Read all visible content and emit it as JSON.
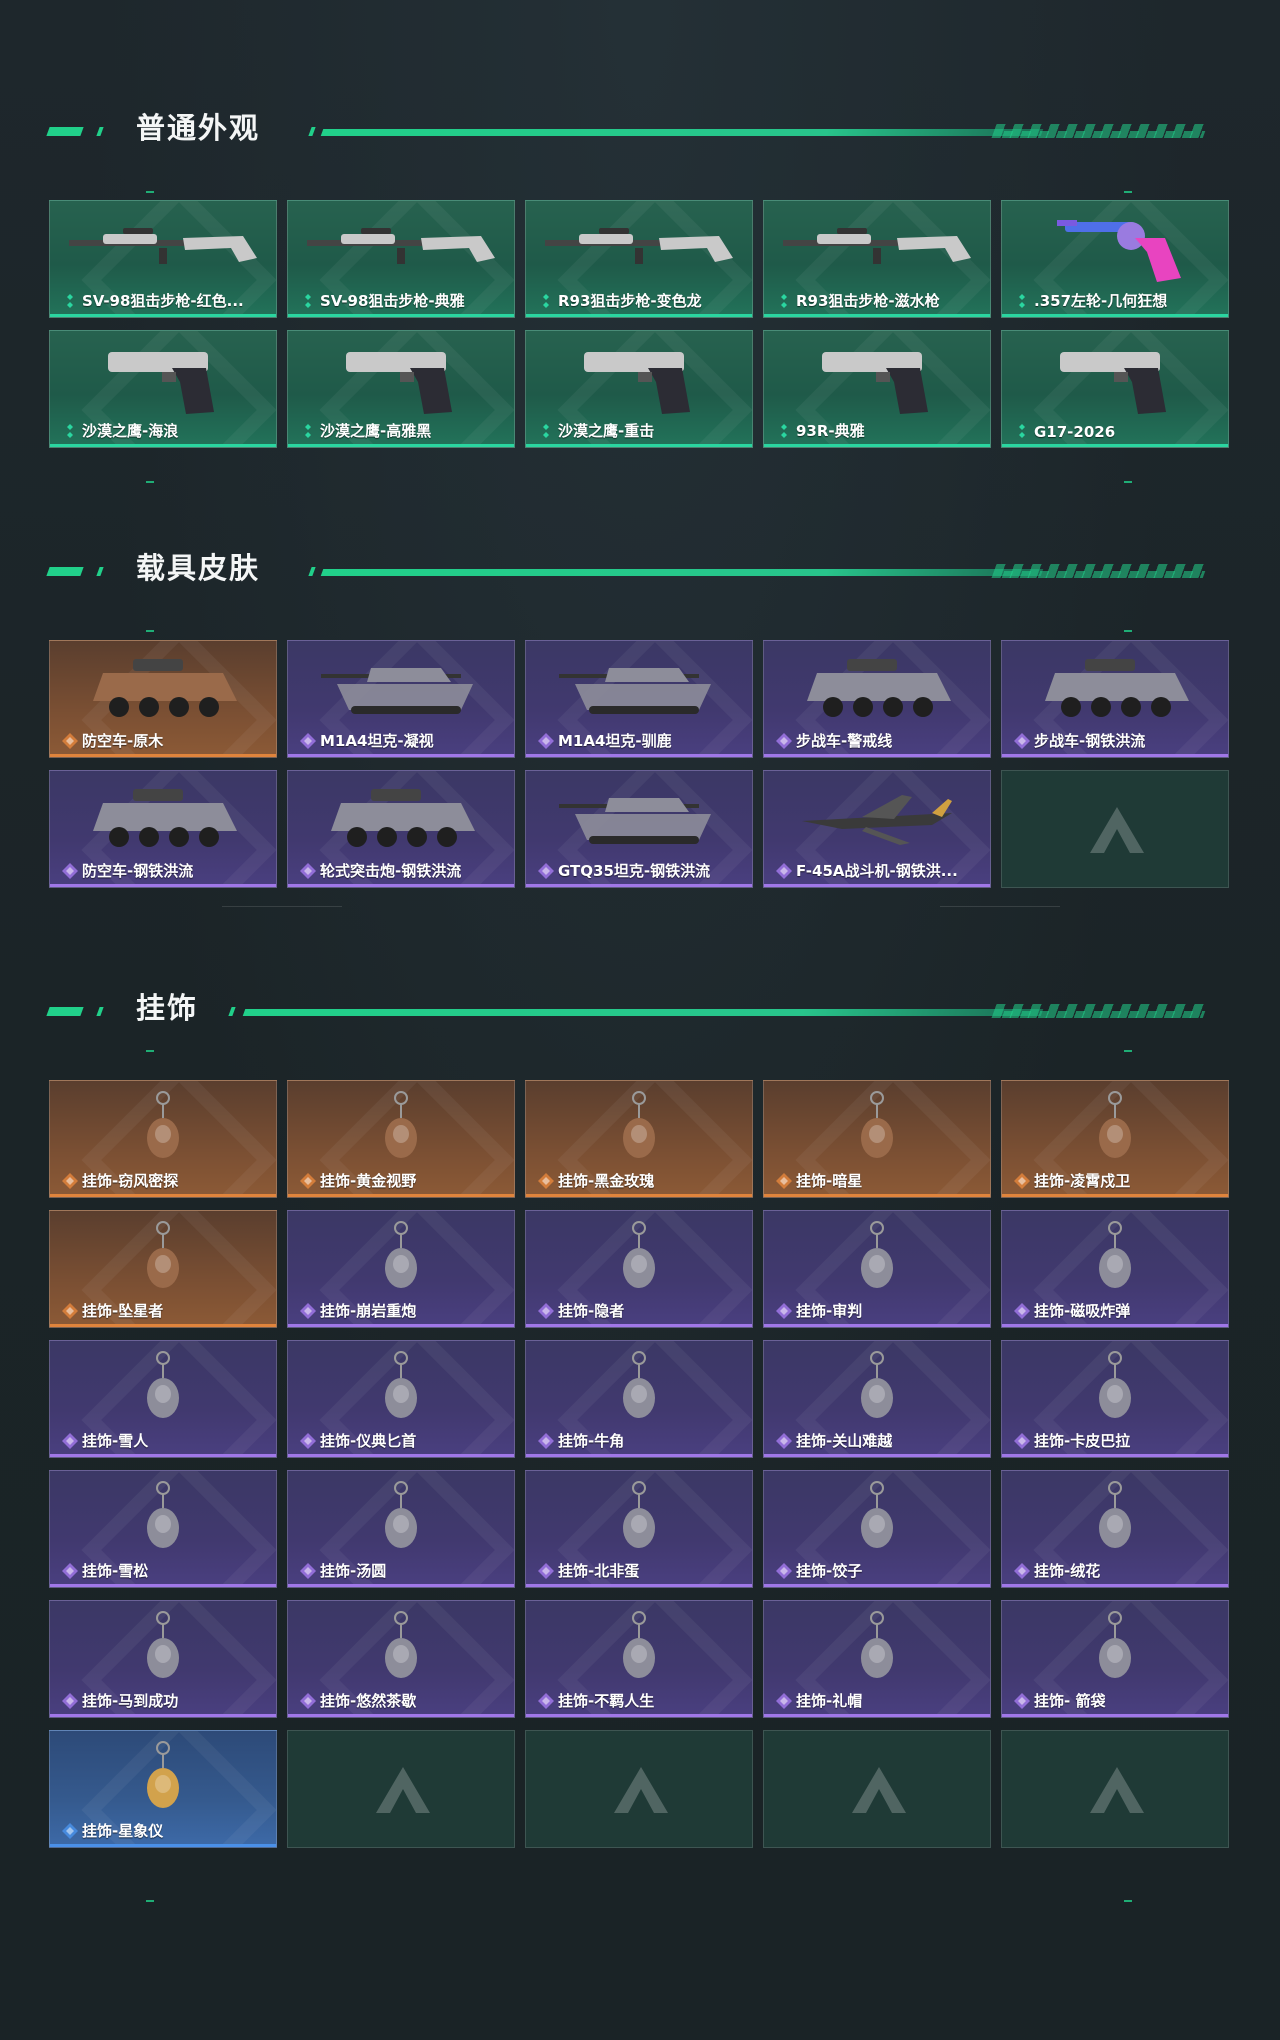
{
  "sections": [
    {
      "title": "普通外观",
      "items": [
        {
          "label": "SV-98狙击步枪-红色...",
          "rarity": "green",
          "icon": "sniper-rifle-icon"
        },
        {
          "label": "SV-98狙击步枪-典雅",
          "rarity": "green",
          "icon": "sniper-rifle-icon"
        },
        {
          "label": "R93狙击步枪-变色龙",
          "rarity": "green",
          "icon": "sniper-rifle-icon"
        },
        {
          "label": "R93狙击步枪-滋水枪",
          "rarity": "green",
          "icon": "sniper-rifle-icon"
        },
        {
          "label": ".357左轮-几何狂想",
          "rarity": "green",
          "icon": "revolver-icon"
        },
        {
          "label": "沙漠之鹰-海浪",
          "rarity": "green",
          "icon": "pistol-icon"
        },
        {
          "label": "沙漠之鹰-高雅黑",
          "rarity": "green",
          "icon": "pistol-icon"
        },
        {
          "label": "沙漠之鹰-重击",
          "rarity": "green",
          "icon": "pistol-icon"
        },
        {
          "label": "93R-典雅",
          "rarity": "green",
          "icon": "pistol-icon"
        },
        {
          "label": "G17-2026",
          "rarity": "green",
          "icon": "pistol-icon"
        }
      ]
    },
    {
      "title": "载具皮肤",
      "items": [
        {
          "label": "防空车-原木",
          "rarity": "orange",
          "icon": "armored-vehicle-icon"
        },
        {
          "label": "M1A4坦克-凝视",
          "rarity": "purple",
          "icon": "tank-icon"
        },
        {
          "label": "M1A4坦克-驯鹿",
          "rarity": "purple",
          "icon": "tank-icon"
        },
        {
          "label": "步战车-警戒线",
          "rarity": "purple",
          "icon": "armored-vehicle-icon"
        },
        {
          "label": "步战车-钢铁洪流",
          "rarity": "purple",
          "icon": "armored-vehicle-icon"
        },
        {
          "label": "防空车-钢铁洪流",
          "rarity": "purple",
          "icon": "armored-vehicle-icon"
        },
        {
          "label": "轮式突击炮-钢铁洪流",
          "rarity": "purple",
          "icon": "armored-vehicle-icon"
        },
        {
          "label": "GTQ35坦克-钢铁洪流",
          "rarity": "purple",
          "icon": "tank-icon"
        },
        {
          "label": "F-45A战斗机-钢铁洪...",
          "rarity": "purple",
          "icon": "fighter-jet-icon"
        },
        {
          "label": "",
          "rarity": "empty",
          "icon": ""
        }
      ]
    },
    {
      "title": "挂饰",
      "items": [
        {
          "label": "挂饰-窃风密探",
          "rarity": "orange",
          "icon": "charm-icon"
        },
        {
          "label": "挂饰-黄金视野",
          "rarity": "orange",
          "icon": "charm-icon"
        },
        {
          "label": "挂饰-黑金玫瑰",
          "rarity": "orange",
          "icon": "charm-icon"
        },
        {
          "label": "挂饰-暗星",
          "rarity": "orange",
          "icon": "charm-icon"
        },
        {
          "label": "挂饰-凌霄戍卫",
          "rarity": "orange",
          "icon": "charm-icon"
        },
        {
          "label": "挂饰-坠星者",
          "rarity": "orange",
          "icon": "charm-icon"
        },
        {
          "label": "挂饰-崩岩重炮",
          "rarity": "purple",
          "icon": "charm-icon"
        },
        {
          "label": "挂饰-隐者",
          "rarity": "purple",
          "icon": "charm-icon"
        },
        {
          "label": "挂饰-审判",
          "rarity": "purple",
          "icon": "charm-icon"
        },
        {
          "label": "挂饰-磁吸炸弹",
          "rarity": "purple",
          "icon": "charm-icon"
        },
        {
          "label": "挂饰-雪人",
          "rarity": "purple",
          "icon": "charm-icon"
        },
        {
          "label": "挂饰-仪典匕首",
          "rarity": "purple",
          "icon": "charm-icon"
        },
        {
          "label": "挂饰-牛角",
          "rarity": "purple",
          "icon": "charm-icon"
        },
        {
          "label": "挂饰-关山难越",
          "rarity": "purple",
          "icon": "charm-icon"
        },
        {
          "label": "挂饰-卡皮巴拉",
          "rarity": "purple",
          "icon": "charm-icon"
        },
        {
          "label": "挂饰-雪松",
          "rarity": "purple",
          "icon": "charm-icon"
        },
        {
          "label": "挂饰-汤圆",
          "rarity": "purple",
          "icon": "charm-icon"
        },
        {
          "label": "挂饰-北非蛋",
          "rarity": "purple",
          "icon": "charm-icon"
        },
        {
          "label": "挂饰-饺子",
          "rarity": "purple",
          "icon": "charm-icon"
        },
        {
          "label": "挂饰-绒花",
          "rarity": "purple",
          "icon": "charm-icon"
        },
        {
          "label": "挂饰-马到成功",
          "rarity": "purple",
          "icon": "charm-icon"
        },
        {
          "label": "挂饰-悠然茶歇",
          "rarity": "purple",
          "icon": "charm-icon"
        },
        {
          "label": "挂饰-不羁人生",
          "rarity": "purple",
          "icon": "charm-icon"
        },
        {
          "label": "挂饰-礼帽",
          "rarity": "purple",
          "icon": "charm-icon"
        },
        {
          "label": "挂饰- 箭袋",
          "rarity": "purple",
          "icon": "charm-icon"
        },
        {
          "label": "挂饰-星象仪",
          "rarity": "blue",
          "icon": "charm-icon"
        },
        {
          "label": "",
          "rarity": "empty",
          "icon": ""
        },
        {
          "label": "",
          "rarity": "empty",
          "icon": ""
        },
        {
          "label": "",
          "rarity": "empty",
          "icon": ""
        },
        {
          "label": "",
          "rarity": "empty",
          "icon": ""
        }
      ]
    }
  ],
  "colors": {
    "accent": "#21d08a",
    "rarity_green": "#2ad6a0",
    "rarity_orange": "#e0843c",
    "rarity_purple": "#a077e8",
    "rarity_blue": "#4a90e8"
  }
}
